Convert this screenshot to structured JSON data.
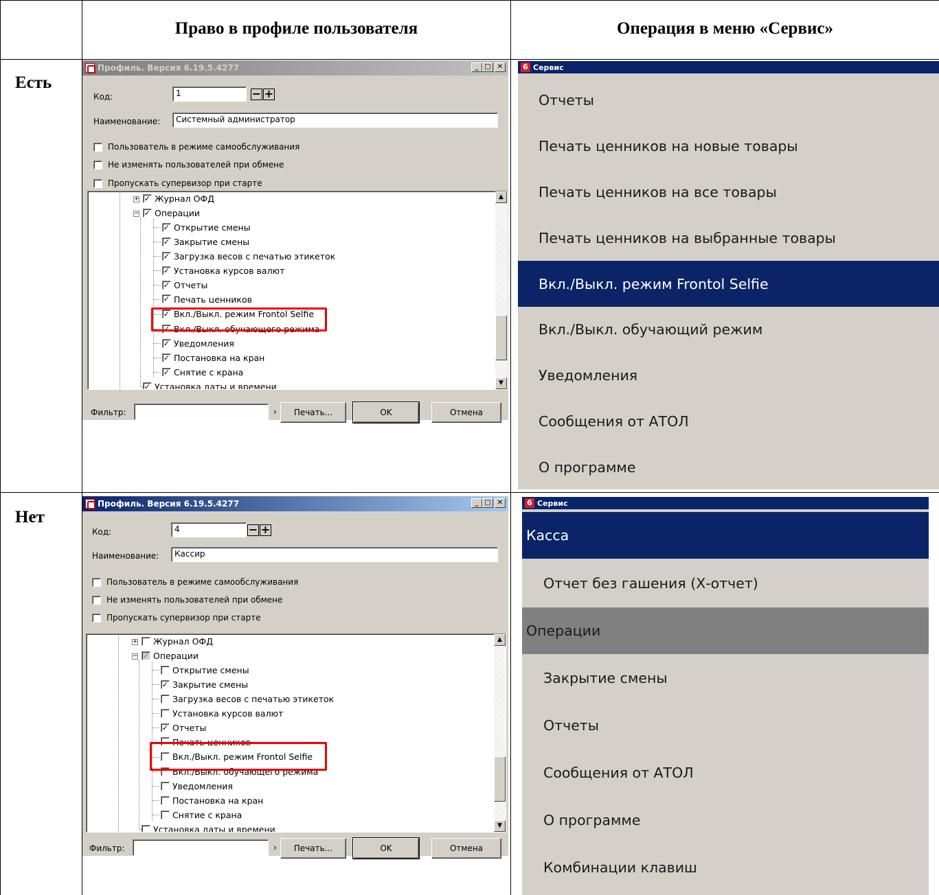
{
  "table": {
    "col_header_1": "Право в профиле пользователя",
    "col_header_2": "Операция в меню «Сервис»",
    "row_1_label": "Есть",
    "row_2_label": "Нет"
  },
  "profile_window": {
    "title": "Профиль. Версия 6.19.5.4277",
    "win_btn_min": "_",
    "win_btn_max": "□",
    "win_btn_close": "✕",
    "code_label": "Код:",
    "name_label": "Наименование:",
    "spin_minus": "−",
    "spin_plus": "+",
    "cb1_label": "Пользователь в режиме самообслуживания",
    "cb2_label": "Не изменять пользователей при обмене",
    "cb3_label": "Пропускать супервизор при старте",
    "filter_label": "Фильтр:",
    "filter_arrow": "›",
    "print_button": "Печать...",
    "ok_button": "OK",
    "cancel_button": "Отмена",
    "scroll_up": "▲",
    "scroll_down": "▼",
    "check_mark": "✓",
    "expand_plus": "+",
    "expand_minus": "−",
    "tree_labels": [
      "Журнал ОФД",
      "Операции",
      "Открытие смены",
      "Закрытие смены",
      "Загрузка весов с печатью этикеток",
      "Установка курсов валют",
      "Отчеты",
      "Печать ценников",
      "Вкл./Выкл. режим Frontol Selfie",
      "Вкл./Выкл. обучающего режима",
      "Уведомления",
      "Постановка на кран",
      "Снятие с крана",
      "Установка даты и времени"
    ]
  },
  "profile_admin": {
    "code_value": "1",
    "name_value": "Системный администратор"
  },
  "profile_cashier": {
    "code_value": "4",
    "name_value": "Кассир"
  },
  "service_menu": {
    "title": "Сервис",
    "icon_digit": "6",
    "admin_items": [
      "Отчеты",
      "Печать ценников на новые товары",
      "Печать ценников на все товары",
      "Печать ценников на выбранные товары",
      "Вкл./Выкл. режим Frontol Selfie",
      "Вкл./Выкл. обучающий режим",
      "Уведомления",
      "Сообщения от АТОЛ",
      "О программе"
    ],
    "cashier_items": [
      "Касса",
      "Отчет без гашения (Х-отчет)",
      "Операции",
      "Закрытие смены",
      "Отчеты",
      "Сообщения от АТОЛ",
      "О программе",
      "Комбинации клавиш"
    ]
  },
  "colors": {
    "menu_selected": "#0a2467",
    "menu_group": "#808080",
    "highlight_box": "#e00000"
  }
}
